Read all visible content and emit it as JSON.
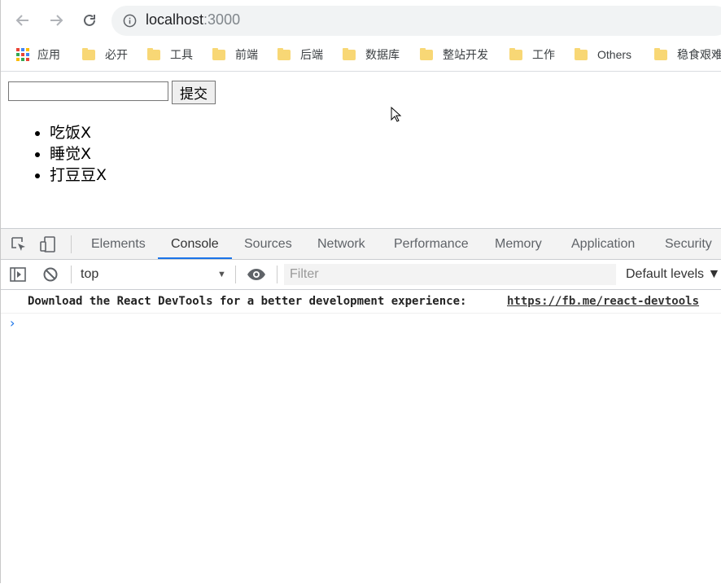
{
  "browser": {
    "url_host": "localhost",
    "url_port": ":3000",
    "bookmarks": [
      "应用",
      "必开",
      "工具",
      "前端",
      "后端",
      "数据库",
      "整站开发",
      "工作",
      "Others",
      "稳食艰难"
    ]
  },
  "page": {
    "submit_label": "提交",
    "input_value": "",
    "todos": [
      "吃饭X",
      "睡觉X",
      "打豆豆X"
    ]
  },
  "devtools": {
    "tabs": [
      "Elements",
      "Console",
      "Sources",
      "Network",
      "Performance",
      "Memory",
      "Application",
      "Security"
    ],
    "active_tab": "Console",
    "context": "top",
    "filter_placeholder": "Filter",
    "levels": "Default levels ▼",
    "message": "Download the React DevTools for a better development experience:",
    "message_link": "https://fb.me/react-devtools",
    "prompt": "›"
  },
  "colors": {
    "accent": "#1a73e8",
    "folder": "#f8d775"
  }
}
